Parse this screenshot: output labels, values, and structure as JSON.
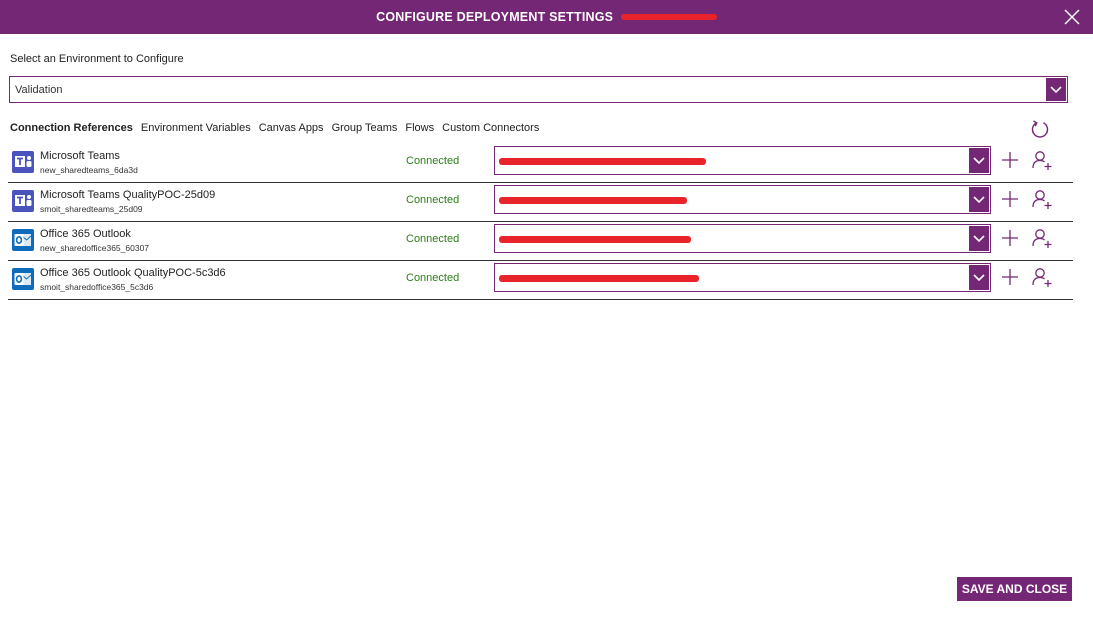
{
  "dialog": {
    "title": "CONFIGURE DEPLOYMENT SETTINGS",
    "accent_color": "#742774"
  },
  "environment": {
    "label": "Select an Environment to Configure",
    "selected": "Validation"
  },
  "tabs": [
    {
      "label": "Connection References",
      "active": true
    },
    {
      "label": "Environment Variables",
      "active": false
    },
    {
      "label": "Canvas Apps",
      "active": false
    },
    {
      "label": "Group Teams",
      "active": false
    },
    {
      "label": "Flows",
      "active": false
    },
    {
      "label": "Custom Connectors",
      "active": false
    }
  ],
  "connections": [
    {
      "name": "Microsoft Teams",
      "logical_name": "new_sharedteams_6da3d",
      "status": "Connected",
      "icon": "teams-icon"
    },
    {
      "name": "Microsoft Teams QualityPOC-25d09",
      "logical_name": "smoit_sharedteams_25d09",
      "status": "Connected",
      "icon": "teams-icon"
    },
    {
      "name": "Office 365 Outlook",
      "logical_name": "new_sharedoffice365_60307",
      "status": "Connected",
      "icon": "outlook-icon"
    },
    {
      "name": "Office 365 Outlook QualityPOC-5c3d6",
      "logical_name": "smoit_sharedoffice365_5c3d6",
      "status": "Connected",
      "icon": "outlook-icon"
    }
  ],
  "footer": {
    "save_label": "SAVE AND CLOSE"
  },
  "status_color": "#2d7d1a"
}
